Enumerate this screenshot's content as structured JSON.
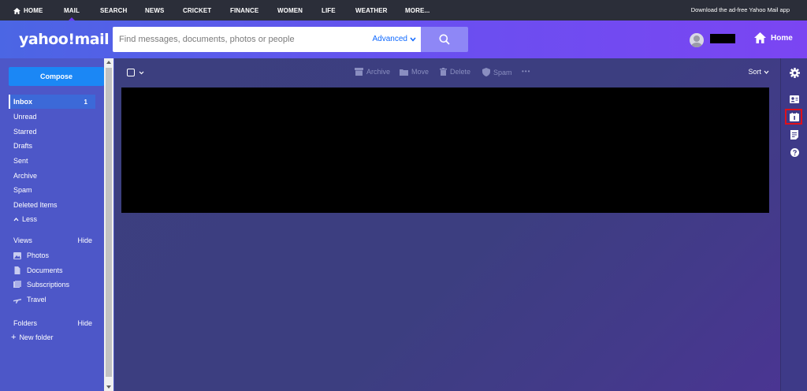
{
  "topnav": {
    "items": [
      {
        "label": "HOME",
        "icon": "home-icon"
      },
      {
        "label": "MAIL",
        "active": true
      },
      {
        "label": "SEARCH"
      },
      {
        "label": "NEWS"
      },
      {
        "label": "CRICKET"
      },
      {
        "label": "FINANCE"
      },
      {
        "label": "WOMEN"
      },
      {
        "label": "LIFE"
      },
      {
        "label": "WEATHER"
      },
      {
        "label": "MORE..."
      }
    ],
    "promo": "Download the ad-free Yahoo Mail app"
  },
  "header": {
    "logo": "yahoo!mail",
    "search_placeholder": "Find messages, documents, photos or people",
    "advanced_label": "Advanced",
    "home_label": "Home"
  },
  "sidebar": {
    "compose_label": "Compose",
    "folders": [
      {
        "label": "Inbox",
        "count": "1",
        "selected": true
      },
      {
        "label": "Unread"
      },
      {
        "label": "Starred"
      },
      {
        "label": "Drafts"
      },
      {
        "label": "Sent"
      },
      {
        "label": "Archive"
      },
      {
        "label": "Spam"
      },
      {
        "label": "Deleted Items"
      }
    ],
    "less_label": "Less",
    "views_label": "Views",
    "views_hide": "Hide",
    "views": [
      {
        "label": "Photos",
        "icon": "photos-icon"
      },
      {
        "label": "Documents",
        "icon": "documents-icon"
      },
      {
        "label": "Subscriptions",
        "icon": "subscriptions-icon"
      },
      {
        "label": "Travel",
        "icon": "travel-icon"
      }
    ],
    "folders_label": "Folders",
    "folders_hide": "Hide",
    "new_folder_label": "New folder"
  },
  "toolbar": {
    "archive_label": "Archive",
    "move_label": "Move",
    "delete_label": "Delete",
    "spam_label": "Spam",
    "more_label": "•••",
    "sort_label": "Sort"
  },
  "rightrail": {
    "icons": [
      "settings-icon",
      "contacts-icon",
      "calendar-icon",
      "notepad-icon",
      "help-icon"
    ]
  },
  "colors": {
    "accent": "#1b87f5",
    "highlight": "#e0101a"
  }
}
